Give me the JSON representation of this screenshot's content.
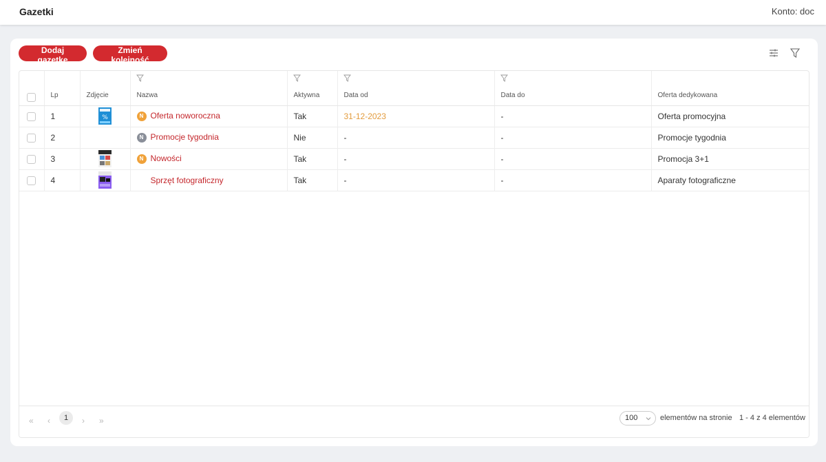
{
  "header": {
    "title": "Gazetki",
    "account": "Konto: doc"
  },
  "toolbar": {
    "add_label": "Dodaj gazetkę",
    "reorder_label": "Zmień kolejność",
    "settings_icon": "sliders-icon",
    "filter_icon": "funnel-icon"
  },
  "table": {
    "columns": {
      "lp": "Lp",
      "photo": "Zdjęcie",
      "name": "Nazwa",
      "active": "Aktywna",
      "date_from": "Data od",
      "date_to": "Data do",
      "offer": "Oferta dedykowana"
    },
    "rows": [
      {
        "lp": "1",
        "badge": "N",
        "badge_color": "#f0a23a",
        "name": "Oferta noworoczna",
        "active": "Tak",
        "date_from": "31-12-2023",
        "date_to": "-",
        "offer": "Oferta promocyjna",
        "has_photo": true
      },
      {
        "lp": "2",
        "badge": "N",
        "badge_color": "#8a8f99",
        "name": "Promocje tygodnia",
        "active": "Nie",
        "date_from": "-",
        "date_to": "-",
        "offer": "Promocje tygodnia",
        "has_photo": false
      },
      {
        "lp": "3",
        "badge": "N",
        "badge_color": "#f0a23a",
        "name": "Nowości",
        "active": "Tak",
        "date_from": "-",
        "date_to": "-",
        "offer": "Promocja 3+1",
        "has_photo": true
      },
      {
        "lp": "4",
        "badge": "",
        "badge_color": "",
        "name": "Sprzęt fotograficzny",
        "active": "Tak",
        "date_from": "-",
        "date_to": "-",
        "offer": "Aparaty fotograficzne",
        "has_photo": true
      }
    ]
  },
  "pagination": {
    "first": "«",
    "prev": "‹",
    "current_page": "1",
    "next": "›",
    "last": "»",
    "page_size": "100",
    "per_page_label": "elementów na stronie",
    "range": "1 - 4 z 4 elementów"
  },
  "colors": {
    "accent": "#d32a2f",
    "link": "#c4262b",
    "date": "#e39b3c"
  }
}
